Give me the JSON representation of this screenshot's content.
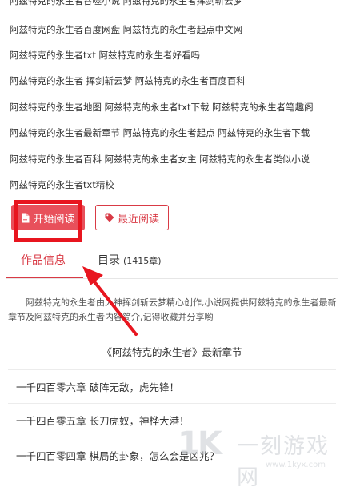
{
  "tags": [
    "阿兹特克的永生者吞噬小说 阿兹特克的永生者挥剑斩云梦",
    "阿兹特克的永生者百度网盘 阿兹特克的永生者起点中文网",
    "阿兹特克的永生者txt 阿兹特克的永生者好看吗",
    "阿兹特克的永生者 挥剑斩云梦 阿兹特克的永生者百度百科",
    "阿兹特克的永生者地图 阿兹特克的永生者txt下载 阿兹特克的永生者笔趣阁",
    "阿兹特克的永生者最新章节 阿兹特克的永生者起点 阿兹特克的永生者下载",
    "阿兹特克的永生者百科 阿兹特克的永生者女主 阿兹特克的永生者类似小说",
    "阿兹特克的永生者txt精校"
  ],
  "buttons": {
    "start_reading": "开始阅读",
    "recent_reading": "最近阅读",
    "start_icon": "document-icon",
    "recent_icon": "tag-icon"
  },
  "tabs": {
    "info": "作品信息",
    "toc": "目录",
    "toc_count": "(1415章)"
  },
  "description": "阿兹特克的永生者由大神挥剑斩云梦精心创作,小说网提供阿兹特克的永生者最新章节及阿兹特克的永生者内容简介,记得收藏并分享哟",
  "latest": {
    "title": "《阿兹特克的永生者》最新章节",
    "chapters": [
      "一千四百零六章 破阵无敌，虎先锋！",
      "一千四百零五章 长刀虎奴，神桦大港！",
      "一千四百零四章 棋局的卦象，怎么会是凶兆？"
    ]
  },
  "watermark": {
    "logo": "1K",
    "name": "一刻游戏网",
    "url": "www.1kyx.com"
  },
  "colors": {
    "accent": "#d93a45",
    "start_button": "#e8505b",
    "annotation": "#e8151f"
  }
}
